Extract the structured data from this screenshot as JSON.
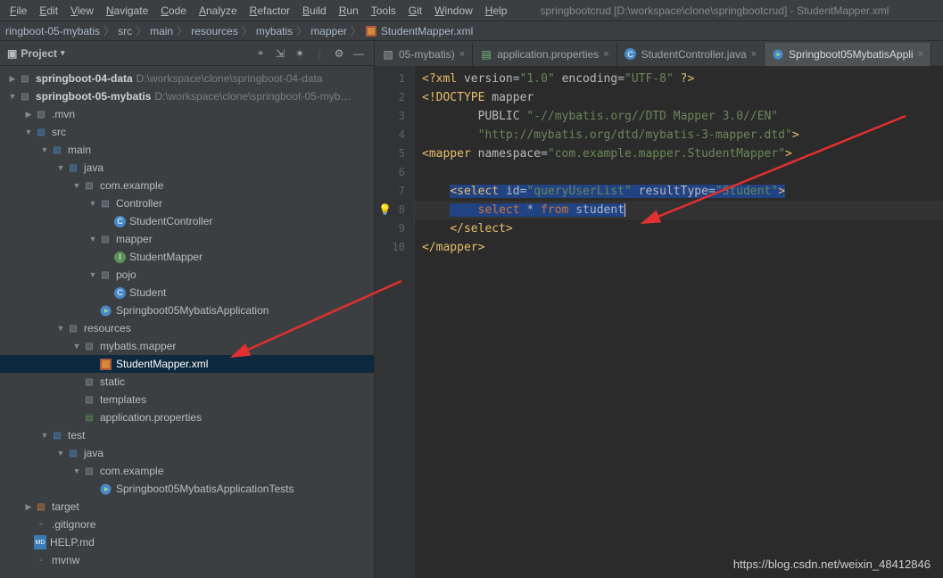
{
  "menu": [
    "File",
    "Edit",
    "View",
    "Navigate",
    "Code",
    "Analyze",
    "Refactor",
    "Build",
    "Run",
    "Tools",
    "Git",
    "Window",
    "Help"
  ],
  "window_title": "springbootcrud [D:\\workspace\\clone\\springbootcrud] - StudentMapper.xml",
  "breadcrumbs": [
    "ringboot-05-mybatis",
    "src",
    "main",
    "resources",
    "mybatis",
    "mapper",
    "StudentMapper.xml"
  ],
  "sidebar": {
    "title": "Project",
    "tree": [
      {
        "d": 0,
        "tw": "▶",
        "icon": "folder",
        "label": "springboot-04-data",
        "dim": "D:\\workspace\\clone\\springboot-04-data",
        "bold": true
      },
      {
        "d": 0,
        "tw": "▼",
        "icon": "folder",
        "label": "springboot-05-mybatis",
        "dim": "D:\\workspace\\clone\\springboot-05-myb…",
        "bold": true
      },
      {
        "d": 1,
        "tw": "▶",
        "icon": "folder",
        "label": ".mvn"
      },
      {
        "d": 1,
        "tw": "▼",
        "icon": "folder-blue",
        "label": "src"
      },
      {
        "d": 2,
        "tw": "▼",
        "icon": "folder-blue",
        "label": "main"
      },
      {
        "d": 3,
        "tw": "▼",
        "icon": "folder-blue",
        "label": "java"
      },
      {
        "d": 4,
        "tw": "▼",
        "icon": "folder",
        "label": "com.example"
      },
      {
        "d": 5,
        "tw": "▼",
        "icon": "folder",
        "label": "Controller"
      },
      {
        "d": 6,
        "tw": "",
        "icon": "class",
        "label": "StudentController"
      },
      {
        "d": 5,
        "tw": "▼",
        "icon": "folder",
        "label": "mapper"
      },
      {
        "d": 6,
        "tw": "",
        "icon": "interface",
        "label": "StudentMapper"
      },
      {
        "d": 5,
        "tw": "▼",
        "icon": "folder",
        "label": "pojo"
      },
      {
        "d": 6,
        "tw": "",
        "icon": "class",
        "label": "Student"
      },
      {
        "d": 5,
        "tw": "",
        "icon": "class-run",
        "label": "Springboot05MybatisApplication"
      },
      {
        "d": 3,
        "tw": "▼",
        "icon": "folder",
        "label": "resources"
      },
      {
        "d": 4,
        "tw": "▼",
        "icon": "folder",
        "label": "mybatis.mapper"
      },
      {
        "d": 5,
        "tw": "",
        "icon": "xml",
        "label": "StudentMapper.xml",
        "selected": true
      },
      {
        "d": 4,
        "tw": "",
        "icon": "folder",
        "label": "static"
      },
      {
        "d": 4,
        "tw": "",
        "icon": "folder",
        "label": "templates"
      },
      {
        "d": 4,
        "tw": "",
        "icon": "cfg",
        "label": "application.properties"
      },
      {
        "d": 2,
        "tw": "▼",
        "icon": "folder-blue",
        "label": "test"
      },
      {
        "d": 3,
        "tw": "▼",
        "icon": "folder-blue",
        "label": "java"
      },
      {
        "d": 4,
        "tw": "▼",
        "icon": "folder",
        "label": "com.example"
      },
      {
        "d": 5,
        "tw": "",
        "icon": "class-run",
        "label": "Springboot05MybatisApplicationTests"
      },
      {
        "d": 1,
        "tw": "▶",
        "icon": "folder-orange",
        "label": "target"
      },
      {
        "d": 1,
        "tw": "",
        "icon": "file",
        "label": ".gitignore"
      },
      {
        "d": 1,
        "tw": "",
        "icon": "md",
        "label": "HELP.md"
      },
      {
        "d": 1,
        "tw": "",
        "icon": "file",
        "label": "mvnw"
      }
    ]
  },
  "tabs": [
    {
      "icon": "folder",
      "label": "05-mybatis)",
      "active": false
    },
    {
      "icon": "cfg",
      "label": "application.properties",
      "active": false
    },
    {
      "icon": "class",
      "label": "StudentController.java",
      "active": false
    },
    {
      "icon": "class-run",
      "label": "Springboot05MybatisAppli",
      "active": true
    }
  ],
  "gutter_lines": [
    "1",
    "2",
    "3",
    "4",
    "5",
    "6",
    "7",
    "8",
    "9",
    "10"
  ],
  "code_lines": [
    {
      "html": "<span class='tok-tag'>&lt;?xml</span> <span class='tok-attr'>version</span>=<span class='tok-str'>\"1.0\"</span> <span class='tok-attr'>encoding</span>=<span class='tok-str'>\"UTF-8\"</span> <span class='tok-tag'>?&gt;</span>"
    },
    {
      "html": "<span class='tok-doctype'>&lt;!DOCTYPE</span> <span class='tok-attr'>mapper</span>"
    },
    {
      "html": "        <span class='tok-attr'>PUBLIC</span> <span class='tok-str'>\"-//mybatis.org//DTD Mapper 3.0//EN\"</span>"
    },
    {
      "html": "        <span class='tok-str'>\"http://mybatis.org/dtd/mybatis-3-mapper.dtd\"</span><span class='tok-doctype'>&gt;</span>"
    },
    {
      "html": "<span class='tok-tag'>&lt;mapper</span> <span class='tok-attr'>namespace</span>=<span class='tok-str'>\"com.example.mapper.StudentMapper\"</span><span class='tok-tag'>&gt;</span>"
    },
    {
      "html": ""
    },
    {
      "html": "    <span class='bg-select'><span class='tok-tag'>&lt;select</span> <span class='tok-attr'>id</span>=<span class='tok-str'>\"queryUserList\"</span> <span class='tok-attr'>resultType</span>=<span class='tok-str'>\"Student\"</span><span class='tok-tag'>&gt;</span></span>"
    },
    {
      "html": "    <span class='bg-select'>    <span class='tok-kw'>select</span> * <span class='tok-kw'>from</span> studen<span class='caret-bar'>t</span></span>",
      "bulb": true
    },
    {
      "html": "    <span class='tok-tag'>&lt;/select&gt;</span>"
    },
    {
      "html": "<span class='tok-tag'>&lt;/mapper&gt;</span>"
    }
  ],
  "watermark": "https://blog.csdn.net/weixin_48412846"
}
